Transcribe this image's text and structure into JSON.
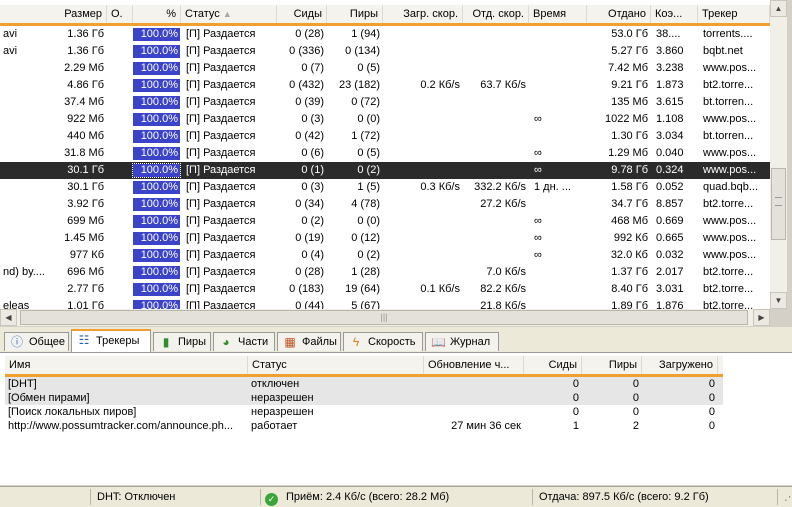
{
  "torrent_list": {
    "columns": [
      "Размер",
      "О.",
      "%",
      "Статус",
      "Сиды",
      "Пиры",
      "Загр. скор.",
      "Отд. скор.",
      "Время",
      "Отдано",
      "Коэ...",
      "Трекер"
    ],
    "rows": [
      {
        "name": "avi",
        "size": "1.36 Гб",
        "pct": "100.0%",
        "status": "[П] Раздается",
        "seeds": "0 (28)",
        "peers": "1 (94)",
        "down": "",
        "up": "",
        "eta": "",
        "uploaded": "53.0 Гб",
        "ratio": "38....",
        "tracker": "torrents...."
      },
      {
        "name": "avi",
        "size": "1.36 Гб",
        "pct": "100.0%",
        "status": "[П] Раздается",
        "seeds": "0 (336)",
        "peers": "0 (134)",
        "down": "",
        "up": "",
        "eta": "",
        "uploaded": "5.27 Гб",
        "ratio": "3.860",
        "tracker": "bqbt.net"
      },
      {
        "name": "",
        "size": "2.29 Мб",
        "pct": "100.0%",
        "status": "[П] Раздается",
        "seeds": "0 (7)",
        "peers": "0 (5)",
        "down": "",
        "up": "",
        "eta": "",
        "uploaded": "7.42 Мб",
        "ratio": "3.238",
        "tracker": "www.pos..."
      },
      {
        "name": "",
        "size": "4.86 Гб",
        "pct": "100.0%",
        "status": "[П] Раздается",
        "seeds": "0 (432)",
        "peers": "23 (182)",
        "down": "0.2 Кб/s",
        "up": "63.7 Кб/s",
        "eta": "",
        "uploaded": "9.21 Гб",
        "ratio": "1.873",
        "tracker": "bt2.torre..."
      },
      {
        "name": "",
        "size": "37.4 Мб",
        "pct": "100.0%",
        "status": "[П] Раздается",
        "seeds": "0 (39)",
        "peers": "0 (72)",
        "down": "",
        "up": "",
        "eta": "",
        "uploaded": "135 Мб",
        "ratio": "3.615",
        "tracker": "bt.torren..."
      },
      {
        "name": "",
        "size": "922 Мб",
        "pct": "100.0%",
        "status": "[П] Раздается",
        "seeds": "0 (3)",
        "peers": "0 (0)",
        "down": "",
        "up": "",
        "eta": "∞",
        "uploaded": "1022 Мб",
        "ratio": "1.108",
        "tracker": "www.pos..."
      },
      {
        "name": "",
        "size": "440 Мб",
        "pct": "100.0%",
        "status": "[П] Раздается",
        "seeds": "0 (42)",
        "peers": "1 (72)",
        "down": "",
        "up": "",
        "eta": "",
        "uploaded": "1.30 Гб",
        "ratio": "3.034",
        "tracker": "bt.torren..."
      },
      {
        "name": "",
        "size": "31.8 Мб",
        "pct": "100.0%",
        "status": "[П] Раздается",
        "seeds": "0 (6)",
        "peers": "0 (5)",
        "down": "",
        "up": "",
        "eta": "∞",
        "uploaded": "1.29 Мб",
        "ratio": "0.040",
        "tracker": "www.pos..."
      },
      {
        "name": "",
        "size": "30.1 Гб",
        "pct": "100.0%",
        "status": "[П] Раздается",
        "seeds": "0 (1)",
        "peers": "0 (2)",
        "down": "",
        "up": "",
        "eta": "∞",
        "uploaded": "9.78 Гб",
        "ratio": "0.324",
        "tracker": "www.pos..."
      },
      {
        "name": "",
        "size": "30.1 Гб",
        "pct": "100.0%",
        "status": "[П] Раздается",
        "seeds": "0 (3)",
        "peers": "1 (5)",
        "down": "0.3 Кб/s",
        "up": "332.2 Кб/s",
        "eta": "1 дн. ...",
        "uploaded": "1.58 Гб",
        "ratio": "0.052",
        "tracker": "quad.bqb..."
      },
      {
        "name": "",
        "size": "3.92 Гб",
        "pct": "100.0%",
        "status": "[П] Раздается",
        "seeds": "0 (34)",
        "peers": "4 (78)",
        "down": "",
        "up": "27.2 Кб/s",
        "eta": "",
        "uploaded": "34.7 Гб",
        "ratio": "8.857",
        "tracker": "bt2.torre..."
      },
      {
        "name": "",
        "size": "699 Мб",
        "pct": "100.0%",
        "status": "[П] Раздается",
        "seeds": "0 (2)",
        "peers": "0 (0)",
        "down": "",
        "up": "",
        "eta": "∞",
        "uploaded": "468 Мб",
        "ratio": "0.669",
        "tracker": "www.pos..."
      },
      {
        "name": "",
        "size": "1.45 Мб",
        "pct": "100.0%",
        "status": "[П] Раздается",
        "seeds": "0 (19)",
        "peers": "0 (12)",
        "down": "",
        "up": "",
        "eta": "∞",
        "uploaded": "992 Кб",
        "ratio": "0.665",
        "tracker": "www.pos..."
      },
      {
        "name": "",
        "size": "977 Кб",
        "pct": "100.0%",
        "status": "[П] Раздается",
        "seeds": "0 (4)",
        "peers": "0 (2)",
        "down": "",
        "up": "",
        "eta": "∞",
        "uploaded": "32.0 Кб",
        "ratio": "0.032",
        "tracker": "www.pos..."
      },
      {
        "name": "nd) by....",
        "size": "696 Мб",
        "pct": "100.0%",
        "status": "[П] Раздается",
        "seeds": "0 (28)",
        "peers": "1 (28)",
        "down": "",
        "up": "7.0 Кб/s",
        "eta": "",
        "uploaded": "1.37 Гб",
        "ratio": "2.017",
        "tracker": "bt2.torre..."
      },
      {
        "name": "",
        "size": "2.77 Гб",
        "pct": "100.0%",
        "status": "[П] Раздается",
        "seeds": "0 (183)",
        "peers": "19 (64)",
        "down": "0.1 Кб/s",
        "up": "82.2 Кб/s",
        "eta": "",
        "uploaded": "8.40 Гб",
        "ratio": "3.031",
        "tracker": "bt2.torre..."
      },
      {
        "name": "eleas",
        "size": "1.01 Гб",
        "pct": "100.0%",
        "status": "[П] Раздается",
        "seeds": "0 (44)",
        "peers": "5 (67)",
        "down": "",
        "up": "21.8 Кб/s",
        "eta": "",
        "uploaded": "1.89 Гб",
        "ratio": "1.876",
        "tracker": "bt2.torre..."
      }
    ],
    "selected_row_value": "30.1 Гб / 9.78 Гб"
  },
  "tabs": [
    {
      "label": "Общее",
      "icon": "info-icon"
    },
    {
      "label": "Трекеры",
      "icon": "network-icon",
      "active": true
    },
    {
      "label": "Пиры",
      "icon": "peers-icon"
    },
    {
      "label": "Части",
      "icon": "pieces-icon"
    },
    {
      "label": "Файлы",
      "icon": "files-icon"
    },
    {
      "label": "Скорость",
      "icon": "speed-icon"
    },
    {
      "label": "Журнал",
      "icon": "log-icon"
    }
  ],
  "trackers": {
    "columns": [
      "Имя",
      "Статус",
      "Обновление ч...",
      "Сиды",
      "Пиры",
      "Загружено"
    ],
    "rows": [
      {
        "name": "[DHT]",
        "status": "отключен",
        "update": "",
        "seeds": "0",
        "peers": "0",
        "downloaded": "0"
      },
      {
        "name": "[Обмен пирами]",
        "status": "неразрешен",
        "update": "",
        "seeds": "0",
        "peers": "0",
        "downloaded": "0"
      },
      {
        "name": "[Поиск локальных пиров]",
        "status": "неразрешен",
        "update": "",
        "seeds": "0",
        "peers": "0",
        "downloaded": "0"
      },
      {
        "name": "http://www.possumtracker.com/announce.ph...",
        "status": "работает",
        "update": "27 мин 36 сек",
        "seeds": "1",
        "peers": "2",
        "downloaded": "0"
      }
    ]
  },
  "statusbar": {
    "dht": "DHT: Отключен",
    "download": "Приём: 2.4 Кб/с (всего: 28.2 Мб)",
    "upload": "Отдача: 897.5 Кб/с (всего: 9.2 Гб)"
  },
  "colors": {
    "accent": "#f0a030",
    "progress": "#3b43c9",
    "selected_row": "#2b2b2b"
  }
}
